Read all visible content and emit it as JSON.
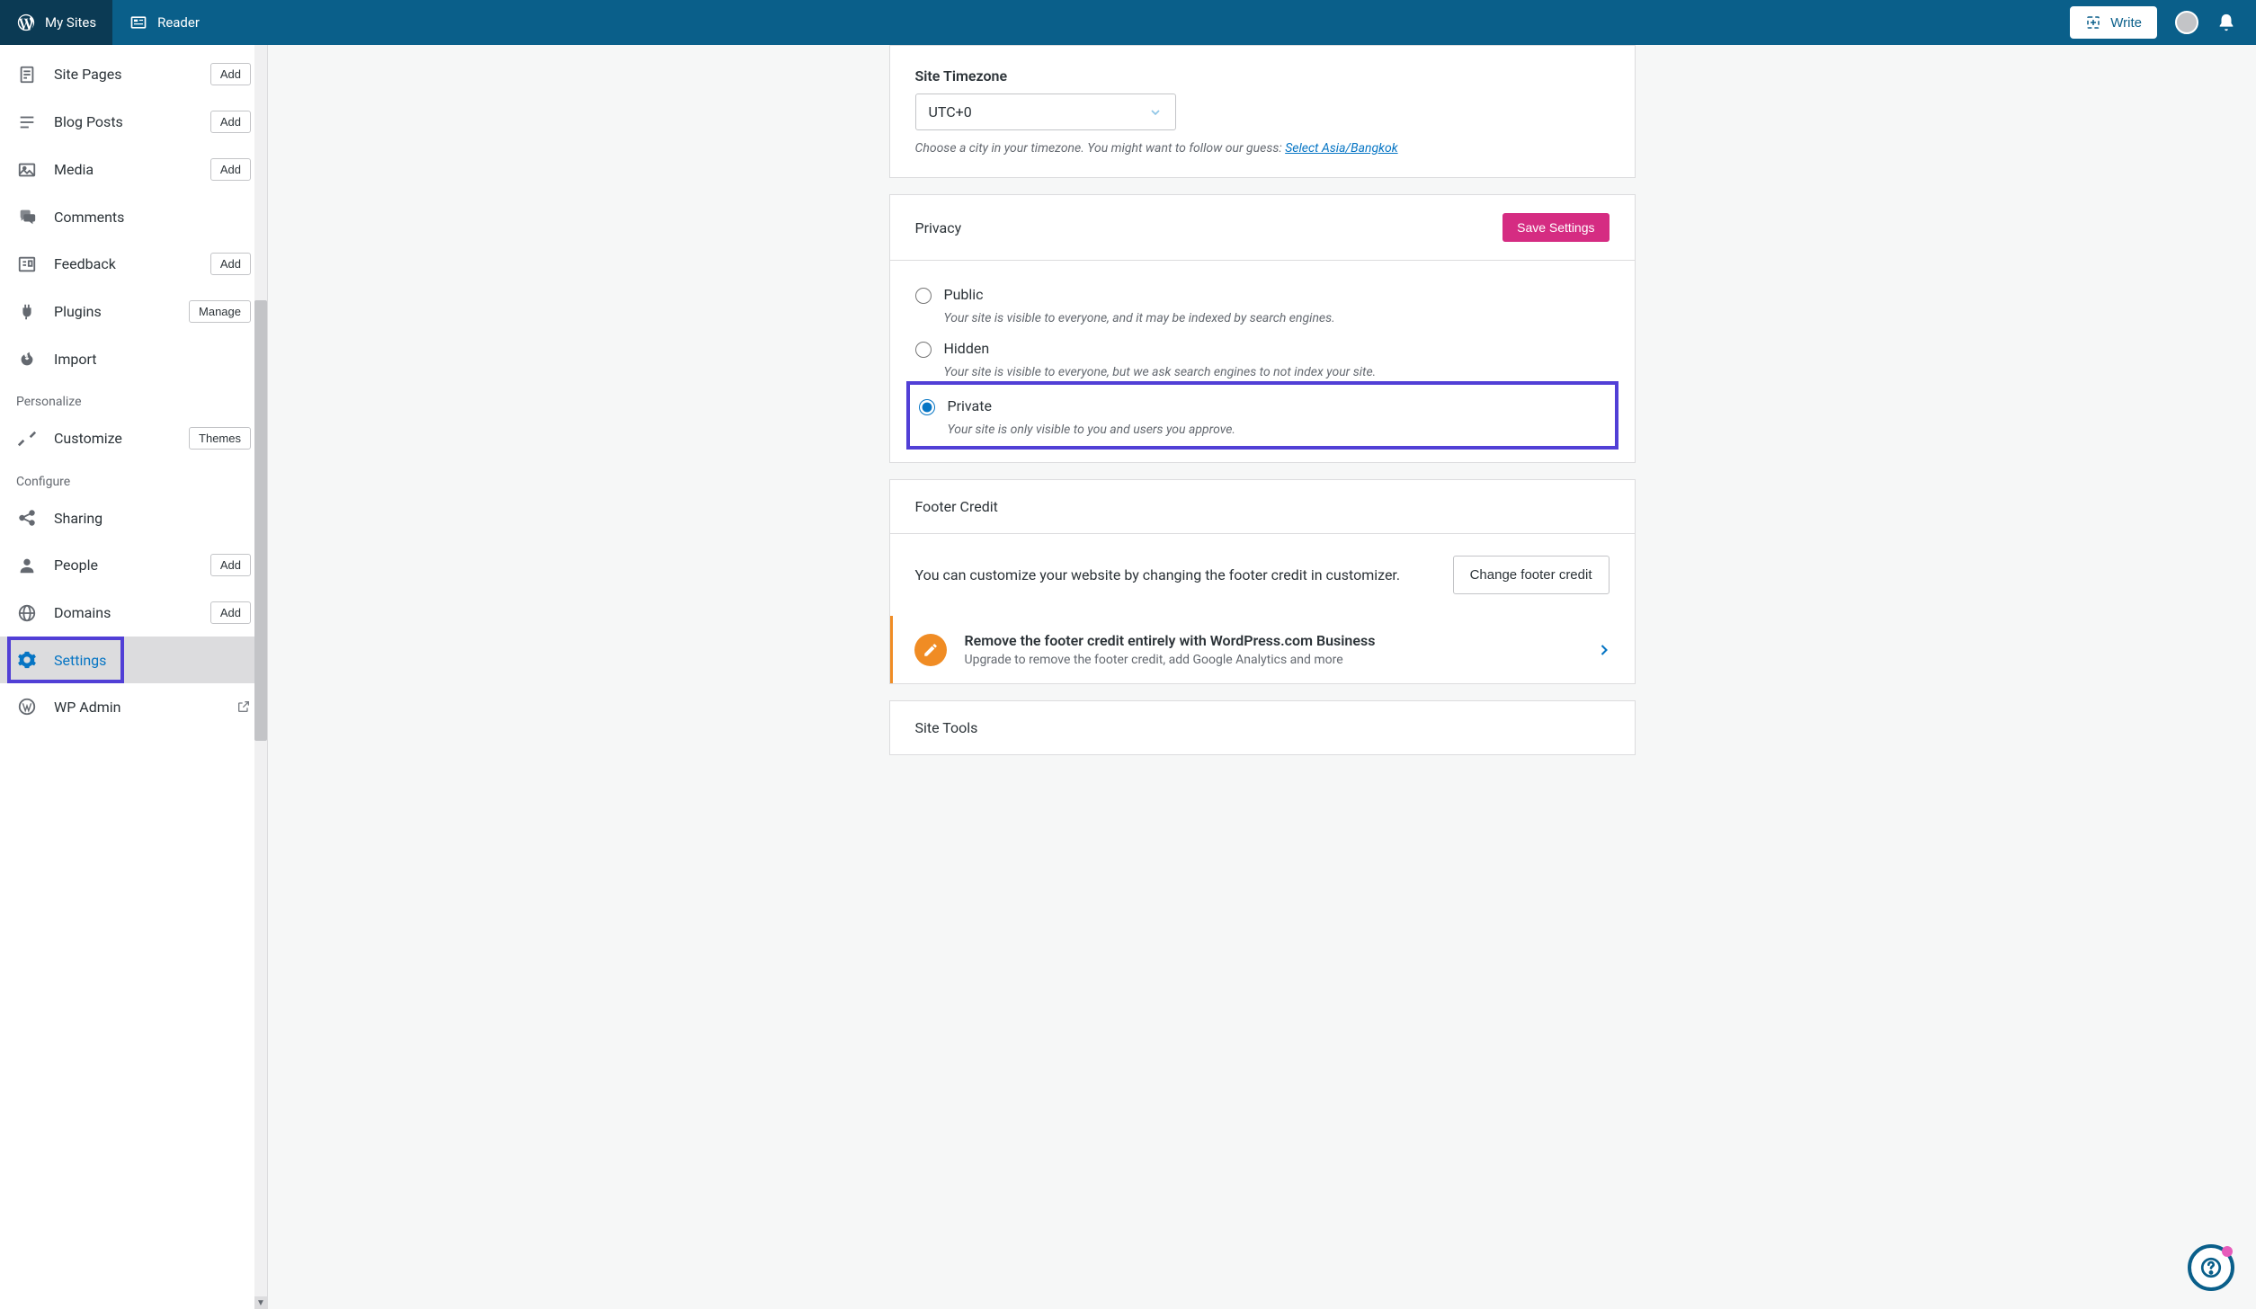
{
  "masterbar": {
    "my_sites": "My Sites",
    "reader": "Reader",
    "write": "Write"
  },
  "sidebar": {
    "items": [
      {
        "label": "Site Pages",
        "action": "Add"
      },
      {
        "label": "Blog Posts",
        "action": "Add"
      },
      {
        "label": "Media",
        "action": "Add"
      },
      {
        "label": "Comments",
        "action": ""
      },
      {
        "label": "Feedback",
        "action": "Add"
      },
      {
        "label": "Plugins",
        "action": "Manage"
      },
      {
        "label": "Import",
        "action": ""
      }
    ],
    "personalize_title": "Personalize",
    "personalize": {
      "label": "Customize",
      "action": "Themes"
    },
    "configure_title": "Configure",
    "configure": [
      {
        "label": "Sharing",
        "action": ""
      },
      {
        "label": "People",
        "action": "Add"
      },
      {
        "label": "Domains",
        "action": "Add"
      },
      {
        "label": "Settings",
        "action": ""
      },
      {
        "label": "WP Admin",
        "action": ""
      }
    ]
  },
  "timezone": {
    "label": "Site Timezone",
    "value": "UTC+0",
    "helper_prefix": "Choose a city in your timezone. You might want to follow our guess: ",
    "helper_link": "Select Asia/Bangkok"
  },
  "privacy": {
    "title": "Privacy",
    "save": "Save Settings",
    "options": [
      {
        "label": "Public",
        "desc": "Your site is visible to everyone, and it may be indexed by search engines.",
        "selected": false
      },
      {
        "label": "Hidden",
        "desc": "Your site is visible to everyone, but we ask search engines to not index your site.",
        "selected": false
      },
      {
        "label": "Private",
        "desc": "Your site is only visible to you and users you approve.",
        "selected": true
      }
    ]
  },
  "footer_credit": {
    "title": "Footer Credit",
    "desc": "You can customize your website by changing the footer credit in customizer.",
    "button": "Change footer credit",
    "upsell_title": "Remove the footer credit entirely with WordPress.com Business",
    "upsell_sub": "Upgrade to remove the footer credit, add Google Analytics and more"
  },
  "site_tools": {
    "title": "Site Tools"
  }
}
